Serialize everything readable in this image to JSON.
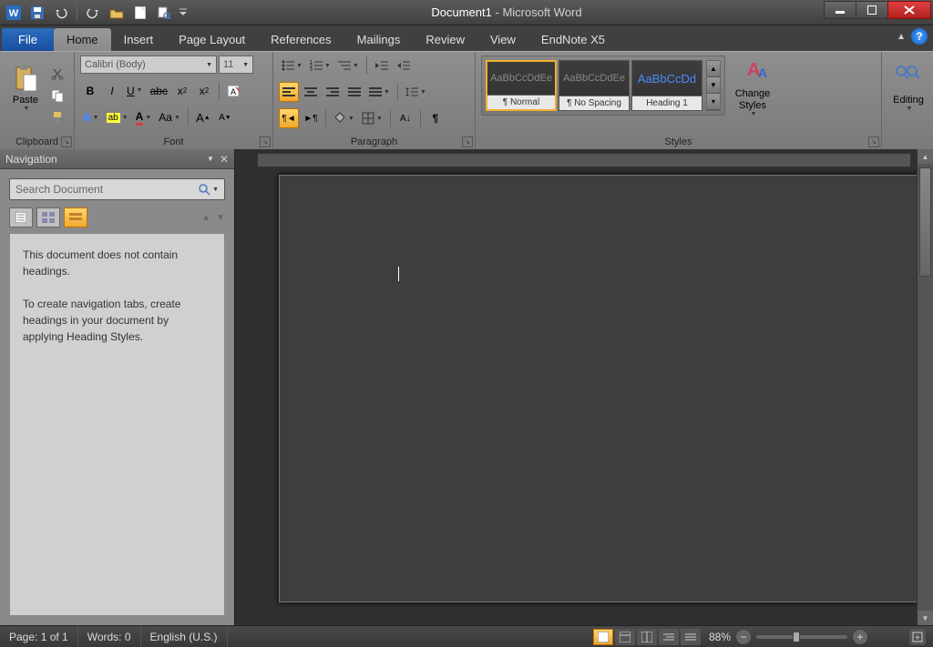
{
  "title": {
    "document": "Document1",
    "app": "Microsoft Word"
  },
  "qat": [
    "word",
    "save",
    "undo",
    "redo",
    "open",
    "new",
    "print-preview"
  ],
  "tabs": {
    "file": "File",
    "items": [
      "Home",
      "Insert",
      "Page Layout",
      "References",
      "Mailings",
      "Review",
      "View",
      "EndNote X5"
    ],
    "active": 0
  },
  "ribbon": {
    "clipboard": {
      "label": "Clipboard",
      "paste": "Paste"
    },
    "font": {
      "label": "Font",
      "name": "Calibri (Body)",
      "size": "11"
    },
    "paragraph": {
      "label": "Paragraph"
    },
    "styles": {
      "label": "Styles",
      "change": "Change\nStyles",
      "items": [
        {
          "preview": "AaBbCcDdEe",
          "name": "¶ Normal",
          "selected": true
        },
        {
          "preview": "AaBbCcDdEe",
          "name": "¶ No Spacing",
          "selected": false
        },
        {
          "preview": "AaBbCcDd",
          "name": "Heading 1",
          "selected": false,
          "heading": true
        }
      ]
    },
    "editing": {
      "label": "Editing"
    }
  },
  "navigation": {
    "title": "Navigation",
    "search_placeholder": "Search Document",
    "msg1": "This document does not contain headings.",
    "msg2": "To create navigation tabs, create headings in your document by applying Heading Styles."
  },
  "status": {
    "page": "Page: 1 of 1",
    "words": "Words: 0",
    "lang": "English (U.S.)",
    "zoom": "88%"
  }
}
